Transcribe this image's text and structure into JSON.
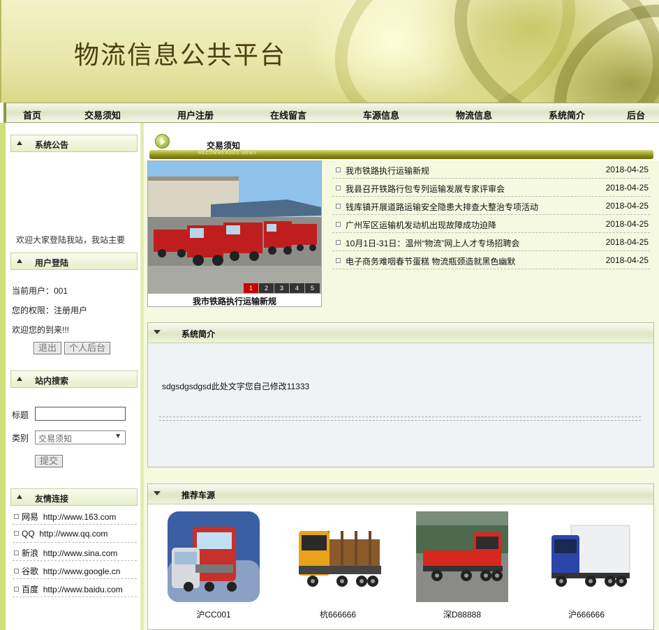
{
  "site": {
    "title": "物流信息公共平台"
  },
  "nav": [
    "首页",
    "交易须知",
    "用户注册",
    "在线留言",
    "车源信息",
    "物流信息",
    "系统简介",
    "后台"
  ],
  "sidebar": {
    "notice": {
      "heading": "系统公告",
      "text": "欢迎大家登陆我站，我站主要"
    },
    "login": {
      "heading": "用户登陆",
      "current_user": "当前用户：001",
      "permission": "您的权限：注册用户",
      "welcome": "欢迎您的到来!!!",
      "logout_label": "退出",
      "backend_label": "个人后台"
    },
    "search": {
      "heading": "站内搜索",
      "title_label": "标题",
      "title_value": "",
      "category_label": "类别",
      "category_value": "交易须知",
      "submit_label": "提交"
    },
    "links": {
      "heading": "友情连接",
      "items": [
        {
          "name": "网易",
          "url": "http://www.163.com"
        },
        {
          "name": "QQ",
          "url": "http://www.qq.com"
        },
        {
          "name": "新浪",
          "url": "http://www.sina.com"
        },
        {
          "name": "谷歌",
          "url": "http://www.google.cn"
        },
        {
          "name": "百度",
          "url": "http://www.baidu.com"
        }
      ]
    }
  },
  "news": {
    "heading": "交易须知",
    "bar_caption": "RECOMMENDED NEWS",
    "featured_caption": "我市铁路执行运输新规",
    "pager": [
      "1",
      "2",
      "3",
      "4",
      "5"
    ],
    "items": [
      {
        "title": "我市铁路执行运输新规",
        "date": "2018-04-25"
      },
      {
        "title": "我县召开铁路行包专列运输发展专家评审会",
        "date": "2018-04-25"
      },
      {
        "title": "钱库镇开展道路运输安全隐患大排查大整治专项活动",
        "date": "2018-04-25"
      },
      {
        "title": "广州军区运输机发动机出现故障成功迫降",
        "date": "2018-04-25"
      },
      {
        "title": "10月1日-31日：温州“物流”网上人才专场招聘会",
        "date": "2018-04-25"
      },
      {
        "title": "电子商务难咽春节蛋糕 物流瓶颈造就黑色幽默",
        "date": "2018-04-25"
      }
    ]
  },
  "intro": {
    "heading": "系统简介",
    "text": "sdgsdgsdgsd此处文字您自己修改11333"
  },
  "vehicles": {
    "heading": "推荐车源",
    "items": [
      {
        "plate": "沪CC001",
        "color": "#c8302c"
      },
      {
        "plate": "杭666666",
        "color": "#e9a21a"
      },
      {
        "plate": "深D88888",
        "color": "#d6281f"
      },
      {
        "plate": "沪666666",
        "color": "#2b46a8"
      }
    ]
  },
  "colors": {
    "accent": "#cfe07a",
    "bar": "#8c8d12",
    "pager_active": "#cc0000"
  }
}
